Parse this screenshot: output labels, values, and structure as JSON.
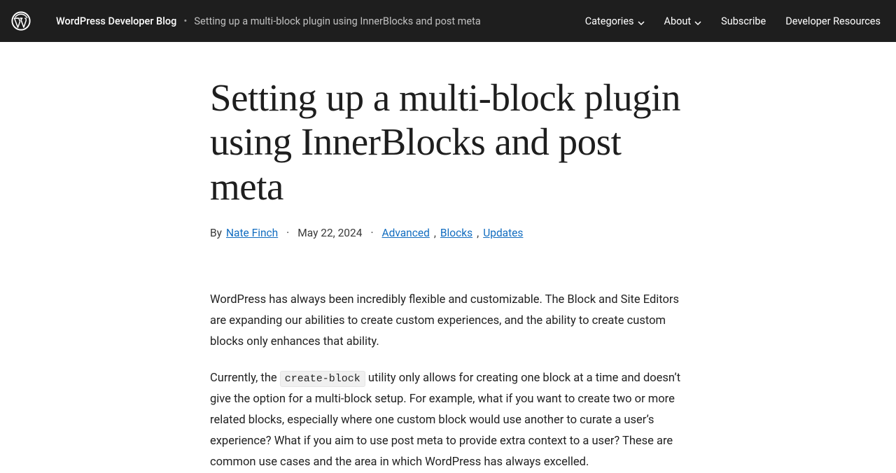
{
  "header": {
    "site_name": "WordPress Developer Blog",
    "breadcrumb_sep": "•",
    "breadcrumb_title": "Setting up a multi-block plugin using InnerBlocks and post meta",
    "nav": {
      "categories": "Categories",
      "about": "About",
      "subscribe": "Subscribe",
      "dev_resources": "Developer Resources"
    }
  },
  "article": {
    "title": "Setting up a multi-block plugin using InnerBlocks and post meta",
    "by_label": "By",
    "author": "Nate Finch",
    "date": "May 22, 2024",
    "tags": {
      "t1": "Advanced",
      "t2": "Blocks",
      "t3": "Updates"
    },
    "dot": "·",
    "comma": ",",
    "para1": "WordPress has always been incredibly flexible and customizable. The Block and Site Editors are expanding our abilities to create custom experiences, and the ability to create custom blocks only enhances that ability.",
    "para2_a": "Currently, the ",
    "para2_code": "create-block",
    "para2_b": " utility only allows for creating one block at a time and doesn’t give the option for a multi-block setup. For example, what if you want to create two or more related blocks, especially where one custom block would use another to curate a user’s experience? What if you aim to use post meta to provide extra context to a user? These are common use cases and the area in which WordPress has always excelled."
  }
}
